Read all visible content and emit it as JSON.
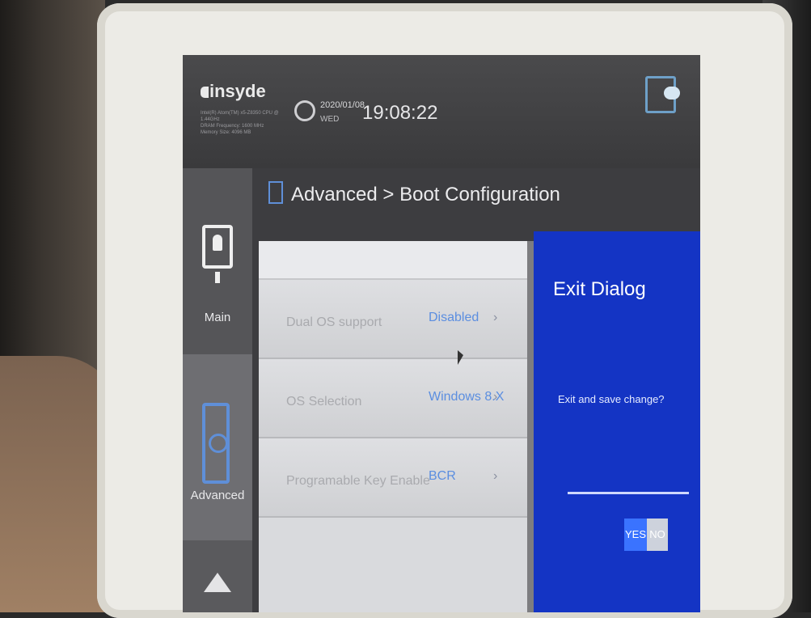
{
  "header": {
    "logo_text": "insyde",
    "sysinfo_lines": [
      "Intel(R) Atom(TM) x5-Z8350  CPU @",
      "1.44GHz",
      "DRAM Frequency: 1600 MHz",
      "Memory Size: 4096 MB"
    ],
    "date": "2020/01/08",
    "time": "19:08:22",
    "day": "WED"
  },
  "sidebar": {
    "items": [
      {
        "label": "Main",
        "icon": "user-monitor-icon"
      },
      {
        "label": "Advanced",
        "icon": "advanced-icon"
      },
      {
        "label": "",
        "icon": "chevron-up-icon"
      }
    ]
  },
  "page": {
    "breadcrumb": "Advanced > Boot Configuration"
  },
  "settings": [
    {
      "label": "Dual OS support",
      "value": "Disabled",
      "chevron": "›"
    },
    {
      "label": "OS Selection",
      "value": "Windows 8.X",
      "chevron": "›"
    },
    {
      "label": "Programable Key Enable",
      "value": "BCR",
      "chevron": "›"
    }
  ],
  "dialog": {
    "title": "Exit Dialog",
    "message": "Exit and save change?",
    "yes_label": "YES",
    "no_label": "NO"
  },
  "colors": {
    "dialog_bg": "#1434c4",
    "accent_blue": "#5b8ee0",
    "yes_selected": "#3a73ff"
  }
}
